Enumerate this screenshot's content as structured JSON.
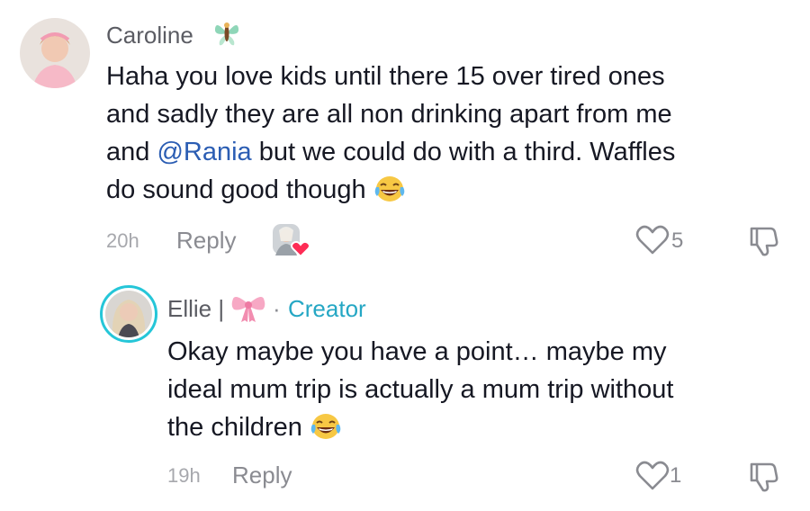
{
  "comment": {
    "username": "Caroline",
    "username_badge_icon": "butterfly-fairy-emoji",
    "text_lines": [
      "Haha you love kids until there 15 over tired ones",
      "and sadly they are all non drinking apart from me"
    ],
    "line3_before": "and ",
    "mention": "@Rania",
    "line3_after": " but we could do with a third. Waffles",
    "line4": "do sound good though",
    "line4_emoji": "laughing-tears-emoji",
    "time": "20h",
    "reply_label": "Reply",
    "likes": "5",
    "creator_liked_icon": "creator-liked-heart-avatar"
  },
  "reply": {
    "username": "Ellie |",
    "username_badge_icon": "pink-bow-emoji",
    "separator": "·",
    "creator_label": "Creator",
    "text_lines": [
      "Okay maybe you have a point… maybe my",
      "ideal mum trip is actually a mum trip without"
    ],
    "line3": "the children",
    "line3_emoji": "laughing-tears-emoji",
    "time": "19h",
    "reply_label": "Reply",
    "likes": "1"
  },
  "colors": {
    "mention": "#2b5db3",
    "creator": "#25a7c4",
    "heart": "#fe2c55",
    "ring": "#25c6d8"
  }
}
